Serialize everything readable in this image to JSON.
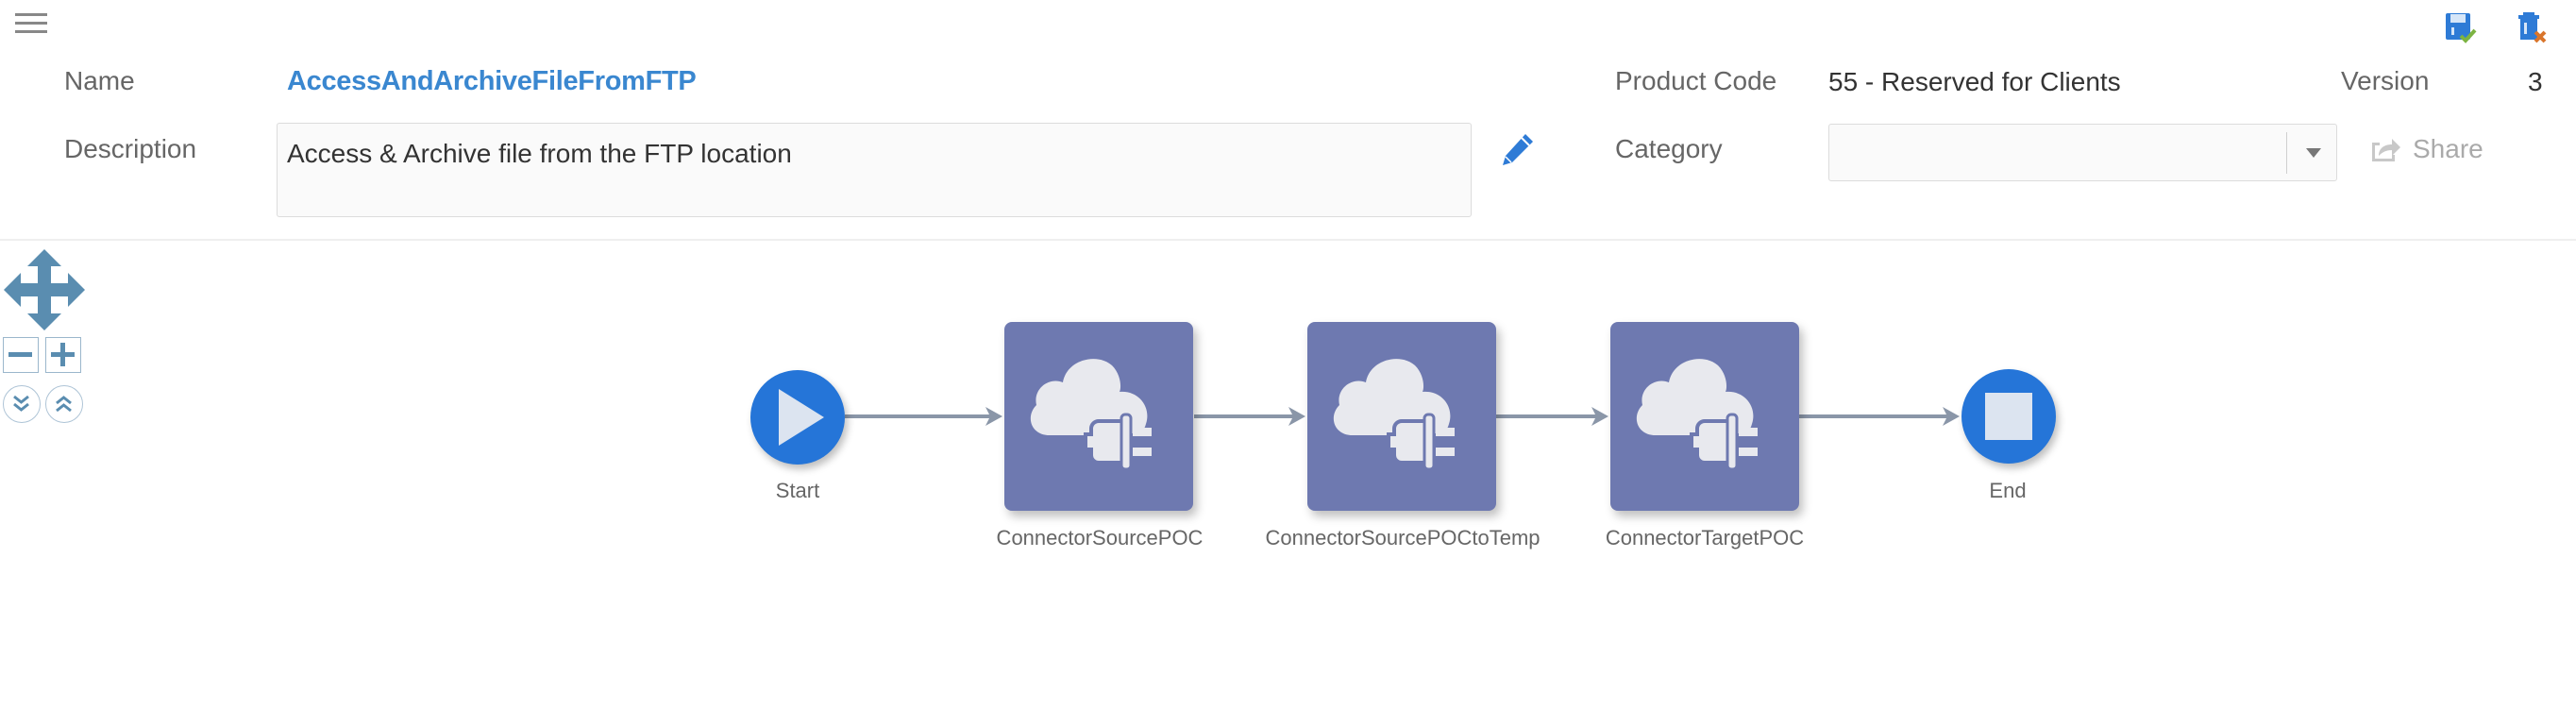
{
  "header": {
    "name_label": "Name",
    "name_value": "AccessAndArchiveFileFromFTP",
    "description_label": "Description",
    "description_value": "Access & Archive file from the FTP location",
    "product_code_label": "Product Code",
    "product_code_value": "55 - Reserved for Clients",
    "version_label": "Version",
    "version_value": "3",
    "category_label": "Category",
    "category_value": "",
    "share_label": "Share"
  },
  "toolbar": {
    "icons": [
      "menu-icon",
      "save-check-icon",
      "delete-icon",
      "edit-pencil-icon",
      "share-icon"
    ]
  },
  "colors": {
    "accent": "#3a87d0",
    "node_box": "#6e79b0",
    "node_circle": "#2575d8",
    "connector": "#8a96a8",
    "nav_control": "#5a8db0"
  },
  "flow": {
    "nodes": [
      {
        "id": "start",
        "type": "start",
        "label": "Start"
      },
      {
        "id": "n1",
        "type": "connector",
        "label": "ConnectorSourcePOC"
      },
      {
        "id": "n2",
        "type": "connector",
        "label": "ConnectorSourcePOCtoTemp"
      },
      {
        "id": "n3",
        "type": "connector",
        "label": "ConnectorTargetPOC"
      },
      {
        "id": "end",
        "type": "end",
        "label": "End"
      }
    ],
    "edges": [
      [
        "start",
        "n1"
      ],
      [
        "n1",
        "n2"
      ],
      [
        "n2",
        "n3"
      ],
      [
        "n3",
        "end"
      ]
    ]
  }
}
